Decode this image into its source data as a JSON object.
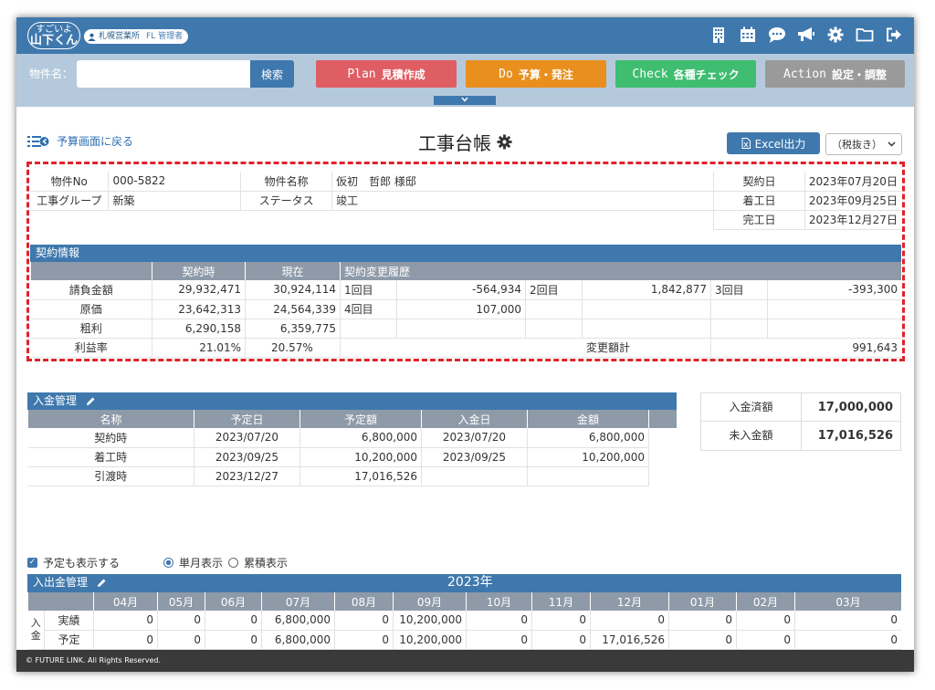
{
  "header": {
    "logo_line1": "すごいよ",
    "logo_line2": "山下くん",
    "office": "札幌営業所",
    "role": "FL 管理者"
  },
  "toolbar": {
    "property_label": "物件名：",
    "search_value": "",
    "search_button": "検索",
    "phases": [
      {
        "key": "Plan",
        "label": "見積作成",
        "color": "#df5e64"
      },
      {
        "key": "Do",
        "label": "予算・発注",
        "color": "#e88f1e"
      },
      {
        "key": "Check",
        "label": "各種チェック",
        "color": "#3fbd70"
      },
      {
        "key": "Action",
        "label": "設定・調整",
        "color": "#9a9a9a"
      }
    ],
    "collapse_icon": "chevron-down"
  },
  "page": {
    "back_label": "予算画面に戻る",
    "title": "工事台帳",
    "excel_label": "Excel出力",
    "tax_select": "（税抜き）"
  },
  "info": {
    "property_no_label": "物件No",
    "property_no": "000-5822",
    "property_name_label": "物件名称",
    "property_name": "仮初　哲郎 様邸",
    "group_label": "工事グループ",
    "group": "新築",
    "status_label": "ステータス",
    "status": "竣工",
    "contract_date_label": "契約日",
    "contract_date": "2023年07月20日",
    "start_date_label": "着工日",
    "start_date": "2023年09月25日",
    "complete_date_label": "完工日",
    "complete_date": "2023年12月27日"
  },
  "contract": {
    "section_title": "契約情報",
    "col_at_contract": "契約時",
    "col_current": "現在",
    "col_history": "契約変更履歴",
    "rows": [
      {
        "label": "請負金額",
        "at_contract": "29,932,471",
        "current": "30,924,114"
      },
      {
        "label": "原価",
        "at_contract": "23,642,313",
        "current": "24,564,339"
      },
      {
        "label": "粗利",
        "at_contract": "6,290,158",
        "current": "6,359,775"
      },
      {
        "label": "利益率",
        "at_contract": "21.01%",
        "current": "20.57%"
      }
    ],
    "history": [
      {
        "n": "1回目",
        "v": "-564,934"
      },
      {
        "n": "2回目",
        "v": "1,842,877"
      },
      {
        "n": "3回目",
        "v": "-393,300"
      },
      {
        "n": "4回目",
        "v": "107,000"
      }
    ],
    "total_label": "変更額計",
    "total": "991,643"
  },
  "payments": {
    "section_title": "入金管理",
    "headers": [
      "名称",
      "予定日",
      "予定額",
      "入金日",
      "金額"
    ],
    "rows": [
      [
        "契約時",
        "2023/07/20",
        "6,800,000",
        "2023/07/20",
        "6,800,000"
      ],
      [
        "着工時",
        "2023/09/25",
        "10,200,000",
        "2023/09/25",
        "10,200,000"
      ],
      [
        "引渡時",
        "2023/12/27",
        "17,016,526",
        "",
        ""
      ]
    ],
    "received_label": "入金済額",
    "received": "17,000,000",
    "unreceived_label": "未入金額",
    "unreceived": "17,016,526"
  },
  "options": {
    "show_planned": "予定も表示する",
    "monthly": "単月表示",
    "cumulative": "累積表示"
  },
  "cashflow": {
    "section_title": "入出金管理",
    "year": "2023年",
    "months": [
      "04月",
      "05月",
      "06月",
      "07月",
      "08月",
      "09月",
      "10月",
      "11月",
      "12月",
      "01月",
      "02月",
      "03月"
    ],
    "group_label": "入金",
    "rows": [
      {
        "label": "実績",
        "values": [
          "0",
          "0",
          "0",
          "6,800,000",
          "0",
          "10,200,000",
          "0",
          "0",
          "0",
          "0",
          "0",
          "0"
        ]
      },
      {
        "label": "予定",
        "values": [
          "0",
          "0",
          "0",
          "6,800,000",
          "0",
          "10,200,000",
          "0",
          "0",
          "17,016,526",
          "0",
          "0",
          "0"
        ]
      }
    ]
  },
  "footer": {
    "copyright": "© FUTURE LINK. All Rights Reserved."
  }
}
